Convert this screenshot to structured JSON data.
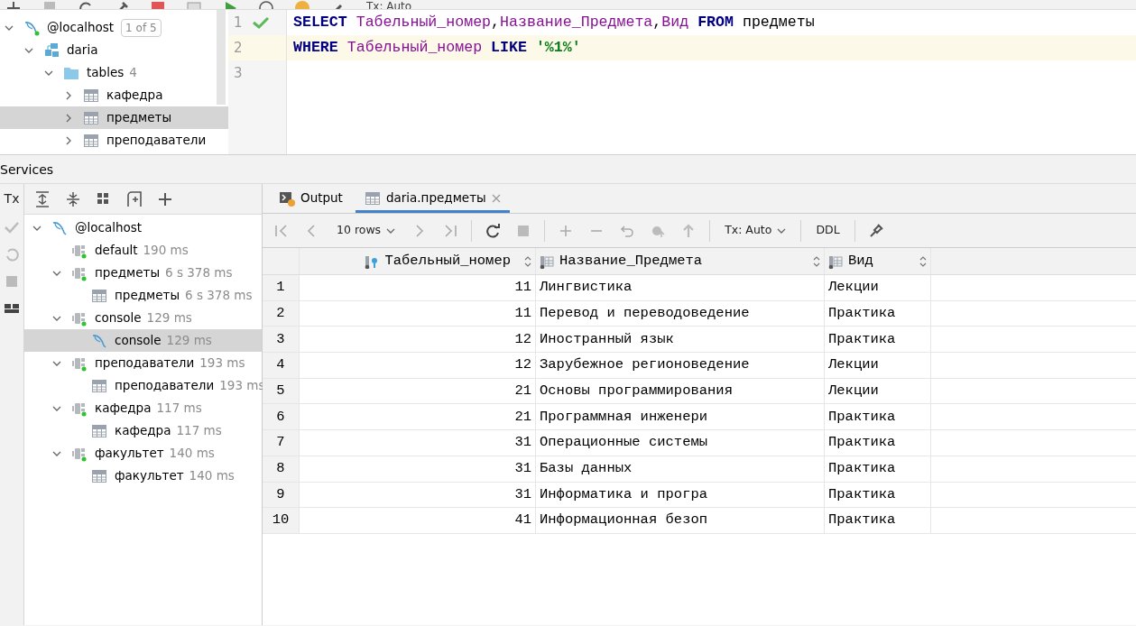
{
  "top_toolbar": {
    "tx_label": "Tx: Auto"
  },
  "db_tree": [
    {
      "label": "@localhost",
      "kind": "host",
      "badge": "1 of 5",
      "expanded": true,
      "selected": false,
      "children": [
        {
          "label": "daria",
          "kind": "schema",
          "expanded": true,
          "selected": false,
          "children": [
            {
              "label": "tables",
              "kind": "folder",
              "count": "4",
              "expanded": true,
              "selected": false,
              "children": [
                {
                  "label": "кафедра",
                  "kind": "table",
                  "expanded": false,
                  "selected": false
                },
                {
                  "label": "предметы",
                  "kind": "table",
                  "expanded": false,
                  "selected": true
                },
                {
                  "label": "преподаватели",
                  "kind": "table",
                  "expanded": false,
                  "selected": false
                }
              ]
            }
          ]
        }
      ]
    }
  ],
  "editor": {
    "lines": [
      {
        "number": "1",
        "current": false,
        "ok": true,
        "tokens": [
          {
            "text": "SELECT",
            "kind": "keyword"
          },
          {
            "text": " Табельный_номер",
            "kind": "ident"
          },
          {
            "text": ",",
            "kind": "plain"
          },
          {
            "text": "Название_Предмета",
            "kind": "ident"
          },
          {
            "text": ",",
            "kind": "plain"
          },
          {
            "text": "Вид",
            "kind": "ident"
          },
          {
            "text": " FROM",
            "kind": "keyword"
          },
          {
            "text": " предметы",
            "kind": "plain"
          }
        ]
      },
      {
        "number": "2",
        "current": true,
        "ok": false,
        "tokens": [
          {
            "text": "WHERE",
            "kind": "keyword"
          },
          {
            "text": " Табельный_номер",
            "kind": "ident"
          },
          {
            "text": " LIKE",
            "kind": "keyword"
          },
          {
            "text": " '%1%'",
            "kind": "string"
          }
        ]
      },
      {
        "number": "3",
        "current": false,
        "ok": false
      }
    ]
  },
  "services": {
    "title": "Services",
    "side_toolbar": {
      "tx_label": "Tx"
    },
    "tree": [
      {
        "label": "@localhost",
        "kind": "host",
        "expanded": true,
        "selected": false,
        "children": [
          {
            "label": "default",
            "kind": "session",
            "time": "190 ms",
            "selected": false
          },
          {
            "label": "предметы",
            "kind": "session",
            "time": "6 s 378 ms",
            "expanded": true,
            "selected": false,
            "children": [
              {
                "label": "предметы",
                "kind": "table",
                "time": "6 s 378 ms",
                "selected": false
              }
            ]
          },
          {
            "label": "console",
            "kind": "session",
            "time": "129 ms",
            "expanded": true,
            "selected": false,
            "children": [
              {
                "label": "console",
                "kind": "host",
                "time": "129 ms",
                "selected": true
              }
            ]
          },
          {
            "label": "преподаватели",
            "kind": "session",
            "time": "193 ms",
            "expanded": true,
            "selected": false,
            "children": [
              {
                "label": "преподаватели",
                "kind": "table",
                "time": "193 ms",
                "selected": false
              }
            ]
          },
          {
            "label": "кафедра",
            "kind": "session",
            "time": "117 ms",
            "expanded": true,
            "selected": false,
            "children": [
              {
                "label": "кафедра",
                "kind": "table",
                "time": "117 ms",
                "selected": false
              }
            ]
          },
          {
            "label": "факультет",
            "kind": "session",
            "time": "140 ms",
            "expanded": true,
            "selected": false,
            "children": [
              {
                "label": "факультет",
                "kind": "table",
                "time": "140 ms",
                "selected": false
              }
            ]
          }
        ]
      }
    ]
  },
  "results": {
    "tabs": [
      {
        "label": "Output",
        "kind": "output",
        "selected": false,
        "closable": false
      },
      {
        "label": "daria.предметы",
        "kind": "table",
        "selected": true,
        "closable": true
      }
    ],
    "toolbar": {
      "page_size": "10 rows",
      "tx_label": "Tx: Auto",
      "ddl": "DDL"
    },
    "columns": [
      {
        "name": "Табельный_номер",
        "kind": "key"
      },
      {
        "name": "Название_Предмета",
        "kind": "text"
      },
      {
        "name": "Вид",
        "kind": "text"
      }
    ],
    "rows": [
      {
        "number": "1",
        "cells": [
          "11",
          "Лингвистика",
          "Лекции"
        ]
      },
      {
        "number": "2",
        "cells": [
          "11",
          "Перевод и переводоведение",
          "Практика"
        ]
      },
      {
        "number": "3",
        "cells": [
          "12",
          "Иностранный язык",
          "Практика"
        ]
      },
      {
        "number": "4",
        "cells": [
          "12",
          "Зарубежное регионоведение",
          "Лекции"
        ]
      },
      {
        "number": "5",
        "cells": [
          "21",
          "Основы программирования",
          "Лекции"
        ]
      },
      {
        "number": "6",
        "cells": [
          "21",
          "Программная инженери",
          "Практика"
        ]
      },
      {
        "number": "7",
        "cells": [
          "31",
          "Операционные системы",
          "Практика"
        ]
      },
      {
        "number": "8",
        "cells": [
          "31",
          "Базы данных",
          "Практика"
        ]
      },
      {
        "number": "9",
        "cells": [
          "31",
          "Информатика и програ",
          "Практика"
        ]
      },
      {
        "number": "10",
        "cells": [
          "41",
          "Информационная безоп",
          "Практика"
        ]
      }
    ]
  }
}
